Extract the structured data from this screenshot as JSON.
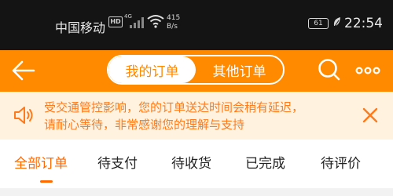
{
  "status_bar": {
    "carrier": "中国移动",
    "hd_badge": "HD",
    "network_type": "4G",
    "speed_value": "415",
    "speed_unit": "B/s",
    "battery_level": "61",
    "time": "22:54"
  },
  "header": {
    "tabs": [
      {
        "label": "我的订单",
        "active": true
      },
      {
        "label": "其他订单",
        "active": false
      }
    ],
    "back_icon": "arrow-left-icon",
    "search_icon": "search-icon",
    "more_icon": "more-dots-icon"
  },
  "notice": {
    "icon": "speaker-icon",
    "text_line1": "受交通管控影响，您的订单送达时间会稍有延迟，",
    "text_line2": "请耐心等待，非常感谢您的理解与支持",
    "close_icon": "close-icon"
  },
  "order_tabs": [
    {
      "label": "全部订单",
      "active": true
    },
    {
      "label": "待支付",
      "active": false
    },
    {
      "label": "待收货",
      "active": false
    },
    {
      "label": "已完成",
      "active": false
    },
    {
      "label": "待评价",
      "active": false
    }
  ],
  "colors": {
    "brand_orange": "#ff8a00",
    "notice_bg": "#fff3e0",
    "notice_text": "#ff7a1a",
    "active_tab": "#ff6a00"
  }
}
